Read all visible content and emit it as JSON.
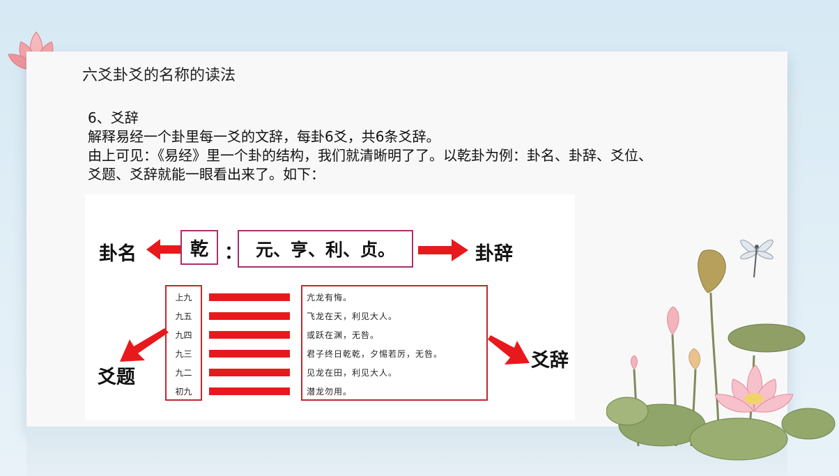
{
  "slide": {
    "title": "六爻卦爻的名称的读法",
    "lines": [
      "6、爻辞",
      "解释易经一个卦里每一爻的文辞，每卦6爻，共6条爻辞。",
      "由上可见：《易经》里一个卦的结构，我们就清晰明了了。以乾卦为例：卦名、卦辞、爻位、",
      "爻题、爻辞就能一眼看出来了。如下："
    ]
  },
  "diagram": {
    "gua_ming_label": "卦名",
    "gua_name": "乾",
    "colon": "：",
    "gua_ci_text": "元、亨、利、贞。",
    "gua_ci_label": "卦辞",
    "yao_ti_label": "爻题",
    "yao_ci_label": "爻辞",
    "yao_titles": [
      "上九",
      "九五",
      "九四",
      "九三",
      "九二",
      "初九"
    ],
    "yao_texts": [
      "亢龙有悔。",
      "飞龙在天，利见大人。",
      "或跃在渊，无咎。",
      "君子终日乾乾，夕惕若厉，无咎。",
      "见龙在田，利见大人。",
      "潜龙勿用。"
    ],
    "colors": {
      "arrow": "#e8191c",
      "box_border": "#c0282d",
      "name_border": "#a5306a"
    }
  },
  "decor": {
    "icons": [
      "lotus-flower-icon",
      "lotus-plants-icon",
      "dragonfly-icon"
    ]
  }
}
